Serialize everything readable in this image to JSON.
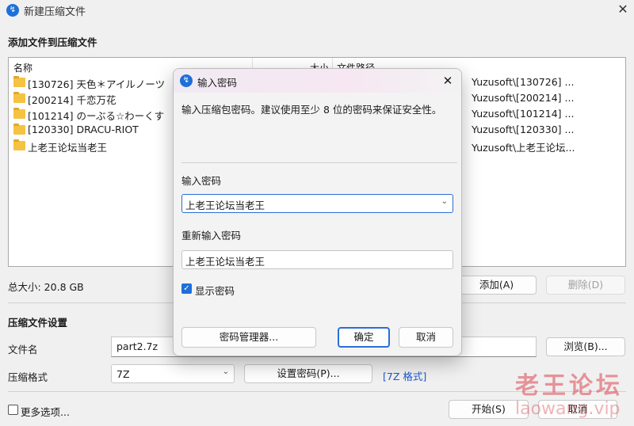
{
  "window": {
    "title": "新建压缩文件",
    "close": "✕"
  },
  "add_section": {
    "title": "添加文件到压缩文件"
  },
  "file_list": {
    "columns": {
      "name": "名称",
      "size": "大小",
      "path": "文件路径"
    },
    "rows": [
      {
        "name": "[130726] 天色＊アイルノーツ",
        "path": "Yuzusoft\\[130726] ..."
      },
      {
        "name": "[200214] 千恋万花",
        "path": "Yuzusoft\\[200214] ..."
      },
      {
        "name": "[101214] のーぶる☆わーくす",
        "path": "Yuzusoft\\[101214] ..."
      },
      {
        "name": "[120330] DRACU-RIOT",
        "path": "Yuzusoft\\[120330] ..."
      },
      {
        "name": "上老王论坛当老王",
        "path": "Yuzusoft\\上老王论坛..."
      }
    ]
  },
  "summary": {
    "total_size": "总大小: 20.8 GB"
  },
  "buttons": {
    "add": "添加(A)",
    "delete": "删除(D)",
    "browse": "浏览(B)...",
    "set_password": "设置密码(P)...",
    "start": "开始(S)",
    "cancel": "取消"
  },
  "settings": {
    "title": "压缩文件设置",
    "filename_label": "文件名",
    "filename_value": "part2.7z",
    "format_label": "压缩格式",
    "format_value": "7Z",
    "format_tag": "[7Z 格式]",
    "more_options": "更多选项..."
  },
  "watermark": {
    "line1": "老王论坛",
    "line2": "laowang.vip"
  },
  "dialog": {
    "title": "输入密码",
    "close": "✕",
    "description": "输入压缩包密码。建议使用至少 8 位的密码来保证安全性。",
    "password_label": "输入密码",
    "password_value": "上老王论坛当老王",
    "confirm_label": "重新输入密码",
    "confirm_value": "上老王论坛当老王",
    "show_password_label": "显示密码",
    "show_password_checked": true,
    "buttons": {
      "manager": "密码管理器...",
      "ok": "确定",
      "cancel": "取消"
    }
  },
  "colors": {
    "accent": "#1e6fd9",
    "link": "#1a57c9",
    "watermark": "#dc4650"
  }
}
